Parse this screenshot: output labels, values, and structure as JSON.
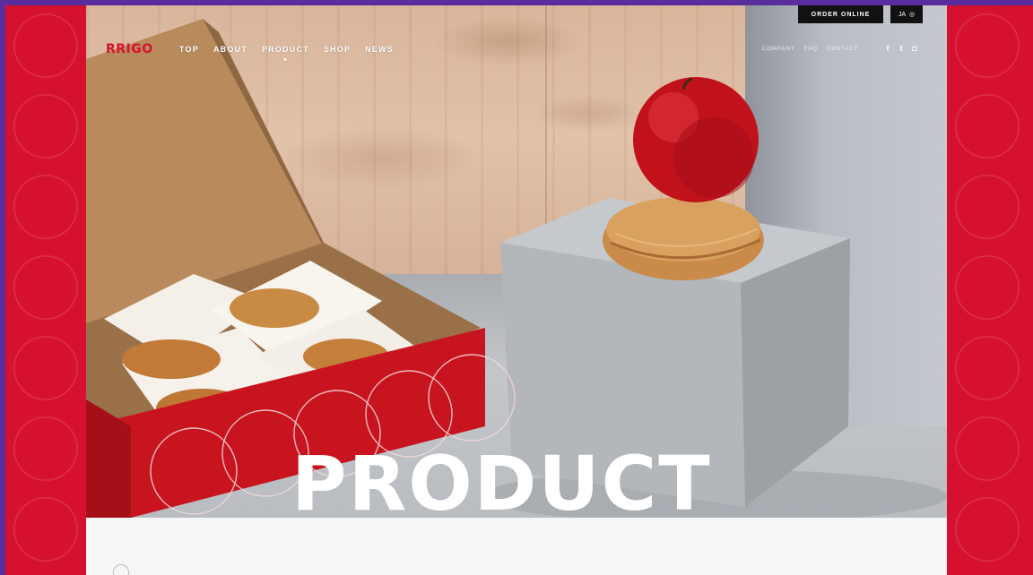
{
  "site": {
    "logo": "RRIGO",
    "brand_color": "#d6112f",
    "accent_bg": "#5a2d9e"
  },
  "topbar": {
    "order_label": "ORDER ONLINE",
    "lang_label": "JA",
    "lang_icon": "globe-icon"
  },
  "nav": {
    "items": [
      "TOP",
      "ABOUT",
      "PRODUCT",
      "SHOP",
      "NEWS"
    ],
    "active": "PRODUCT"
  },
  "util": {
    "links": [
      "COMPANY",
      "FAQ",
      "CONTACT"
    ]
  },
  "social": {
    "icons": [
      "facebook-icon",
      "twitter-icon",
      "instagram-icon"
    ],
    "glyphs": [
      "f",
      "t",
      "◘"
    ]
  },
  "hero": {
    "title": "PRODUCT"
  }
}
